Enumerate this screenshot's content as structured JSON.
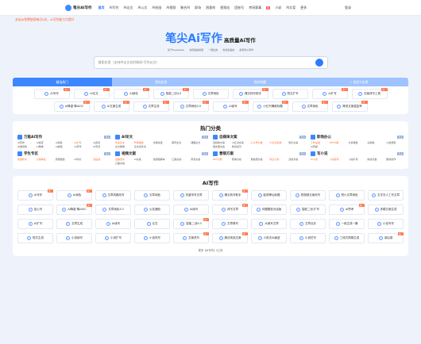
{
  "topbar": {
    "brand": "笔尖AI写作",
    "nav": [
      "首页",
      {
        "t": "AI写作"
      },
      "AI论文",
      "AI公文",
      "AI绘画",
      "AI视频",
      "聚合AI",
      "职场",
      "困意库",
      "视频站",
      "团账号",
      "考研赛事",
      "小说",
      "AI文案",
      "更多"
    ],
    "new_badge": "新",
    "login": "登录"
  },
  "notice": "本站AI免费使用每日5次，AI写作能力大提升",
  "hero": {
    "title": "笔尖Ai写作",
    "subtitle": "高质量Ai写作",
    "tags": [
      "基于DeepSeek",
      "支持最新模型",
      "一键生成",
      "支持多语言",
      "多场景AI写作"
    ]
  },
  "search": {
    "placeholder": "搜索应用（支持AI论文实时联网·写作论文）"
  },
  "tabs": [
    "精选热门",
    "我的应用",
    "我的收藏",
    "+ 自定义应用"
  ],
  "featured": [
    {
      "label": "AI写作",
      "hot": "热门"
    },
    {
      "label": "AI论文",
      "hot": "热门"
    },
    {
      "label": "AI润色",
      "hot": "热门"
    },
    {
      "label": "智能二创4.0",
      "hot": "热门"
    },
    {
      "label": "文章润色",
      "hot": ""
    },
    {
      "label": "爆文转写助手",
      "hot": "热门"
    },
    {
      "label": "短文扩写",
      "hot": ""
    },
    {
      "label": "AI扩写",
      "hot": "热门"
    },
    {
      "label": "文案改写工具",
      "hot": "热门"
    },
    {
      "label": "AI降重·降AIGC",
      "hot": "热门"
    },
    {
      "label": "AI文案生成",
      "hot": "热门"
    },
    {
      "label": "文章生成",
      "hot": "热门"
    },
    {
      "label": "文章润色3.0",
      "hot": "热门"
    },
    {
      "label": "AI续写",
      "hot": "热门"
    },
    {
      "label": "小红书爆款标题",
      "hot": "热门"
    },
    {
      "label": "文章润色",
      "hot": "热门"
    },
    {
      "label": "降低文案重复率",
      "hot": "热门"
    }
  ],
  "hot": {
    "title": "热门分类",
    "more": "更多",
    "cats": [
      {
        "name": "万能AI写作",
        "items": [
          "AI写作",
          "AI续写",
          "AI润色",
          "AI扩写",
          "AI改写",
          "文章润色",
          "AI降重",
          "AI编辑",
          "AI写作",
          "AI写诗"
        ],
        "hl": [
          3
        ]
      },
      {
        "name": "AI论文",
        "items": [
          "毕业论文",
          "开题报告",
          "文献综述",
          "期刊论文",
          "课程论文",
          "论文降重",
          "论文任务书"
        ],
        "hl": [
          0,
          1
        ]
      },
      {
        "name": "自媒体文案",
        "items": [
          "自媒体文案",
          "小红书文案",
          "公众号文章",
          "小红书标题",
          "知乎文案",
          "朋友圈文案",
          "新闻资讯"
        ],
        "hl": [
          2,
          3
        ]
      },
      {
        "name": "职场办公",
        "items": [
          "工作总结",
          "PPT大纲",
          "分析报告",
          "演讲稿",
          "公告通知",
          "AI周报"
        ],
        "hl": [
          0,
          1
        ]
      },
      {
        "name": "学生专区",
        "items": [
          "英语作文",
          "心得体会",
          "调研报告",
          "AI作文",
          "读后感"
        ],
        "hl": [
          0,
          1,
          4
        ]
      },
      {
        "name": "视频文案",
        "items": [
          "直播话术",
          "AI文案",
          "短视频脚本",
          "口播文案",
          "带货文案",
          "口播文案"
        ],
        "hl": [
          0
        ]
      },
      {
        "name": "营销方案",
        "items": [
          "PPT大纲",
          "营销方案",
          "朋友圈文案",
          "商业计划",
          "活动方案"
        ],
        "hl": [
          0,
          3
        ]
      },
      {
        "name": "写小说",
        "items": [
          "AI小说",
          "小说续写",
          "小说扩写",
          "情感文章",
          "剧情创作"
        ],
        "hl": [
          0,
          1
        ]
      }
    ]
  },
  "aiwrite": {
    "title": "AI写作",
    "items": [
      {
        "label": "AI写作",
        "hot": "热门"
      },
      {
        "label": "AI润色",
        "hot": "热门"
      },
      {
        "label": "文章风格改写",
        "hot": ""
      },
      {
        "label": "文章润色",
        "hot": ""
      },
      {
        "label": "关键词写文章",
        "hot": ""
      },
      {
        "label": "爆文转写助手",
        "hot": "热门"
      },
      {
        "label": "脑洞神仙标题",
        "hot": ""
      },
      {
        "label": "短视频文案改写",
        "hot": ""
      },
      {
        "label": "短小文章润色",
        "hot": ""
      },
      {
        "label": "文字去人工写文章",
        "hot": ""
      },
      {
        "label": "加心写",
        "hot": ""
      },
      {
        "label": "AI降重·降AIGC",
        "hot": "热门"
      },
      {
        "label": "文章润色3.0",
        "hot": ""
      },
      {
        "label": "公告通知",
        "hot": ""
      },
      {
        "label": "AI续写",
        "hot": ""
      },
      {
        "label": "改写文章",
        "hot": "热门"
      },
      {
        "label": "问题模型对话版",
        "hot": ""
      },
      {
        "label": "智能二创·扩写",
        "hot": ""
      },
      {
        "label": "AI思考",
        "hot": "热门"
      },
      {
        "label": "多模文案生成",
        "hot": ""
      },
      {
        "label": "AI扩写",
        "hot": ""
      },
      {
        "label": "文章生成",
        "hot": ""
      },
      {
        "label": "AI续写",
        "hot": ""
      },
      {
        "label": "论文",
        "hot": ""
      },
      {
        "label": "智能二创4.0",
        "hot": "热门"
      },
      {
        "label": "文章简写",
        "hot": ""
      },
      {
        "label": "大纲写文章",
        "hot": ""
      },
      {
        "label": "文章合并",
        "hot": ""
      },
      {
        "label": "一段生成一篇",
        "hot": ""
      },
      {
        "label": "小说写作",
        "hot": ""
      },
      {
        "label": "短文生成",
        "hot": ""
      },
      {
        "label": "小说续写",
        "hot": ""
      },
      {
        "label": "小说扩写",
        "hot": ""
      },
      {
        "label": "小说改写",
        "hot": ""
      },
      {
        "label": "文案改写",
        "hot": "热门"
      },
      {
        "label": "魔法商品文案",
        "hot": "热门"
      },
      {
        "label": "小说去AI痕迹",
        "hot": ""
      },
      {
        "label": "小说仿写",
        "hot": ""
      },
      {
        "label": "三段式周报生成",
        "hot": ""
      },
      {
        "label": "读后感",
        "hot": "热门"
      }
    ],
    "footer": "更多【AI写作】4工具"
  }
}
